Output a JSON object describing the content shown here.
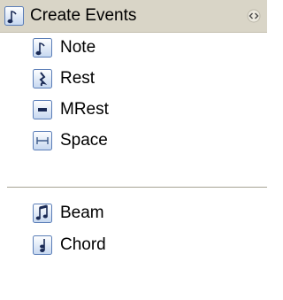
{
  "panel": {
    "title": "Create Events",
    "title_icon": "note-icon",
    "collapse_icon": "double-chevron-icon"
  },
  "items": [
    {
      "label": "Note",
      "icon": "note-icon"
    },
    {
      "label": "Rest",
      "icon": "rest-icon"
    },
    {
      "label": "MRest",
      "icon": "mrest-icon"
    },
    {
      "label": "Space",
      "icon": "space-icon"
    },
    {
      "label": "Beam",
      "icon": "beam-icon"
    },
    {
      "label": "Chord",
      "icon": "chord-icon"
    }
  ],
  "colors": {
    "header_bg": "#d9d5c7",
    "icon_border": "#5b7eb8",
    "icon_fill_top": "#ffffff",
    "icon_fill_bottom": "#c5d7f0"
  }
}
